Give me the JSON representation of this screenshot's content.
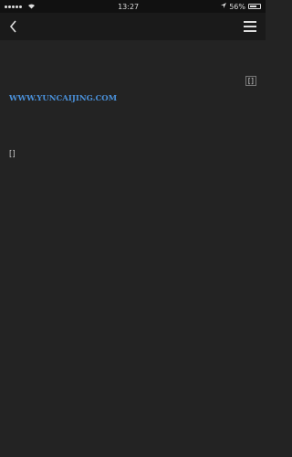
{
  "status_bar": {
    "time": "13:27",
    "carrier": "",
    "battery": "56%"
  },
  "article": {
    "headline": "",
    "time": "",
    "source": "",
    "body_before_link": "",
    "link_text": "WWW.YUNCAIJING.COM",
    "body_after_link": "",
    "disclaimer": ""
  }
}
